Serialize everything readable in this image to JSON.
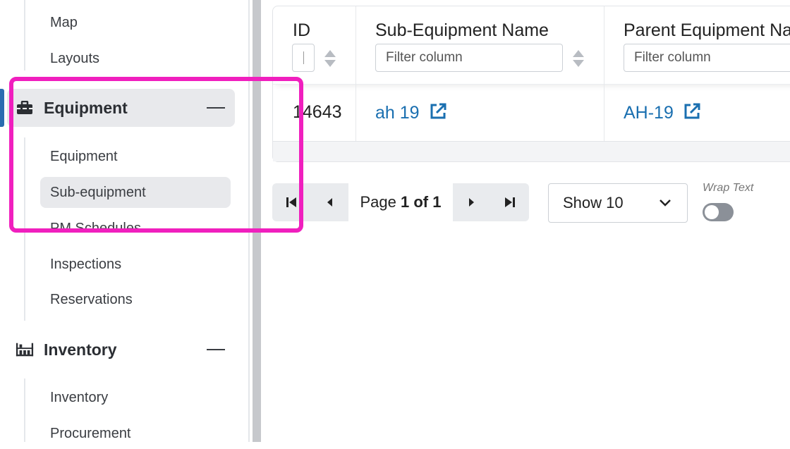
{
  "sidebar": {
    "top_items": [
      {
        "label": "Map"
      },
      {
        "label": "Layouts"
      }
    ],
    "equipment_group": {
      "label": "Equipment",
      "icon": "toolbox-icon",
      "items": [
        {
          "label": "Equipment"
        },
        {
          "label": "Sub-equipment",
          "active": true
        },
        {
          "label": "PM Schedules"
        },
        {
          "label": "Inspections"
        },
        {
          "label": "Reservations"
        }
      ]
    },
    "inventory_group": {
      "label": "Inventory",
      "icon": "shelves-icon",
      "items": [
        {
          "label": "Inventory"
        },
        {
          "label": "Procurement"
        }
      ]
    }
  },
  "table": {
    "columns": [
      {
        "label": "ID",
        "filter_placeholder": ""
      },
      {
        "label": "Sub-Equipment Name",
        "filter_placeholder": "Filter column"
      },
      {
        "label": "Parent Equipment Name",
        "filter_placeholder": "Filter column"
      }
    ],
    "rows": [
      {
        "id": "14643",
        "sub_equipment_name": "ah 19",
        "parent_equipment_name": "AH-19"
      }
    ]
  },
  "pager": {
    "page_prefix": "Page",
    "page_current": "1 of 1",
    "page_size_label": "Show 10",
    "wrap_text_label": "Wrap Text",
    "wrap_text_on": false
  },
  "colors": {
    "accent": "#2b6cb0",
    "link": "#1a6fb0",
    "highlight": "#f01fbe"
  }
}
